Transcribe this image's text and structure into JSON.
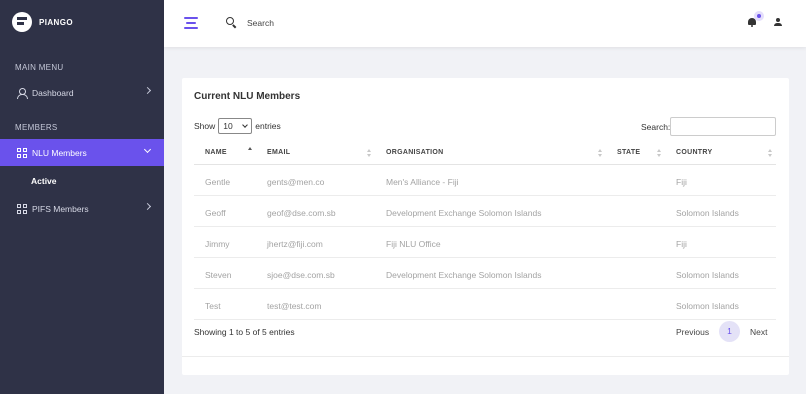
{
  "brand": {
    "name": "PIANGO"
  },
  "sidebar": {
    "main_menu_title": "MAIN MENU",
    "members_title": "MEMBERS",
    "items": [
      {
        "label": "Dashboard",
        "icon": "user-icon"
      },
      {
        "label": "NLU Members",
        "icon": "grid-icon",
        "active": true
      },
      {
        "label": "PIFS Members",
        "icon": "grid-icon"
      }
    ],
    "sub_items": [
      {
        "label": "Active"
      }
    ]
  },
  "header": {
    "search_label": "Search",
    "notification_icon": "bell-icon",
    "profile_icon": "user-icon"
  },
  "card": {
    "title": "Current NLU Members",
    "length": {
      "show_label": "Show",
      "value": "10",
      "entries_label": "entries"
    },
    "search_label": "Search:",
    "search_value": "",
    "columns": [
      "NAME",
      "EMAIL",
      "ORGANISATION",
      "STATE",
      "COUNTRY"
    ],
    "sorted_column": "NAME",
    "sort_direction": "ascending",
    "rows": [
      {
        "name": "Gentle",
        "email": "gents@men.co",
        "organisation": "Men's Alliance - Fiji",
        "state": "",
        "country": "Fiji"
      },
      {
        "name": "Geoff",
        "email": "geof@dse.com.sb",
        "organisation": "Development Exchange Solomon Islands",
        "state": "",
        "country": "Solomon Islands"
      },
      {
        "name": "Jimmy",
        "email": "jhertz@fiji.com",
        "organisation": "Fiji NLU Office",
        "state": "",
        "country": "Fiji"
      },
      {
        "name": "Steven",
        "email": "sjoe@dse.com.sb",
        "organisation": "Development Exchange Solomon Islands",
        "state": "",
        "country": "Solomon Islands"
      },
      {
        "name": "Test",
        "email": "test@test.com",
        "organisation": "",
        "state": "",
        "country": "Solomon Islands"
      }
    ],
    "info": "Showing 1 to 5 of 5 entries",
    "pagination": {
      "previous": "Previous",
      "current": "1",
      "next": "Next"
    }
  },
  "colors": {
    "sidebar_bg": "#2f3247",
    "accent": "#6a52ec",
    "page_bg": "#f1f2f6"
  }
}
